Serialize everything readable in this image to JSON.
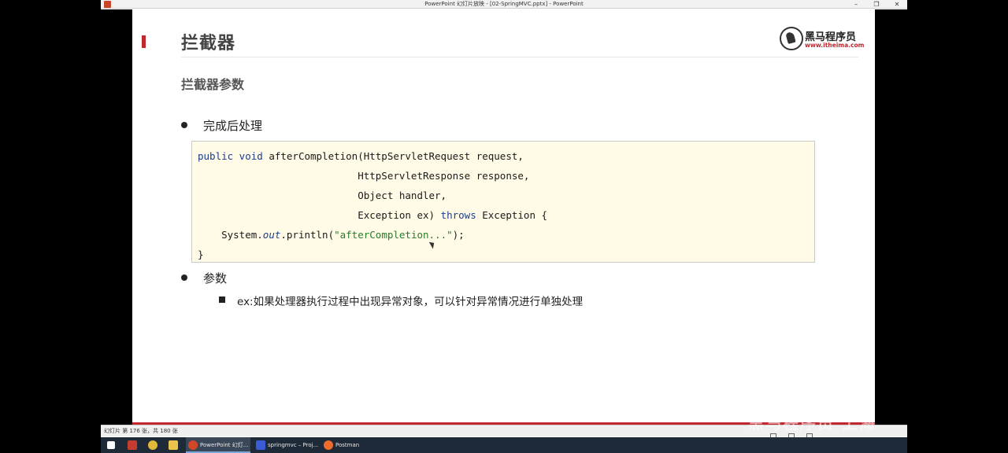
{
  "window": {
    "title": "PowerPoint 幻灯片放映 - [02-SpringMVC.pptx] - PowerPoint",
    "minimize": "–",
    "restore": "❐",
    "close": "✕"
  },
  "slide": {
    "title": "拦截器",
    "subtitle": "拦截器参数",
    "logo": {
      "cn": "黑马程序员",
      "en": "www.itheima.com"
    },
    "bullet1": "完成后处理",
    "code": {
      "line1_kw": "public void ",
      "line1_rest": "afterCompletion(HttpServletRequest request,",
      "line2": "                           HttpServletResponse response,",
      "line3": "                           Object handler,",
      "line4_a": "                           Exception ex) ",
      "line4_kw": "throws",
      "line4_b": " Exception {",
      "line5_a": "    System.",
      "line5_it": "out",
      "line5_b": ".println(",
      "line5_str": "\"afterCompletion...\"",
      "line5_c": ");",
      "line6": "}"
    },
    "bullet2": "参数",
    "sub_bullet": "ex:如果处理器执行过程中出现异常对象，可以针对异常情况进行单独处理"
  },
  "statusbar": {
    "slide_info": "幻灯片 第 176 张，共 180 张"
  },
  "watermark": "黑马程序员 上海",
  "taskbar": {
    "apps": [
      {
        "label": "PowerPoint 幻灯..."
      },
      {
        "label": "springmvc – Proj..."
      },
      {
        "label": "Postman"
      }
    ]
  },
  "colors": {
    "accent_red": "#c0282d",
    "code_bg": "#fffbe6",
    "keyword": "#1a3d8f",
    "string": "#2a7a2a"
  }
}
